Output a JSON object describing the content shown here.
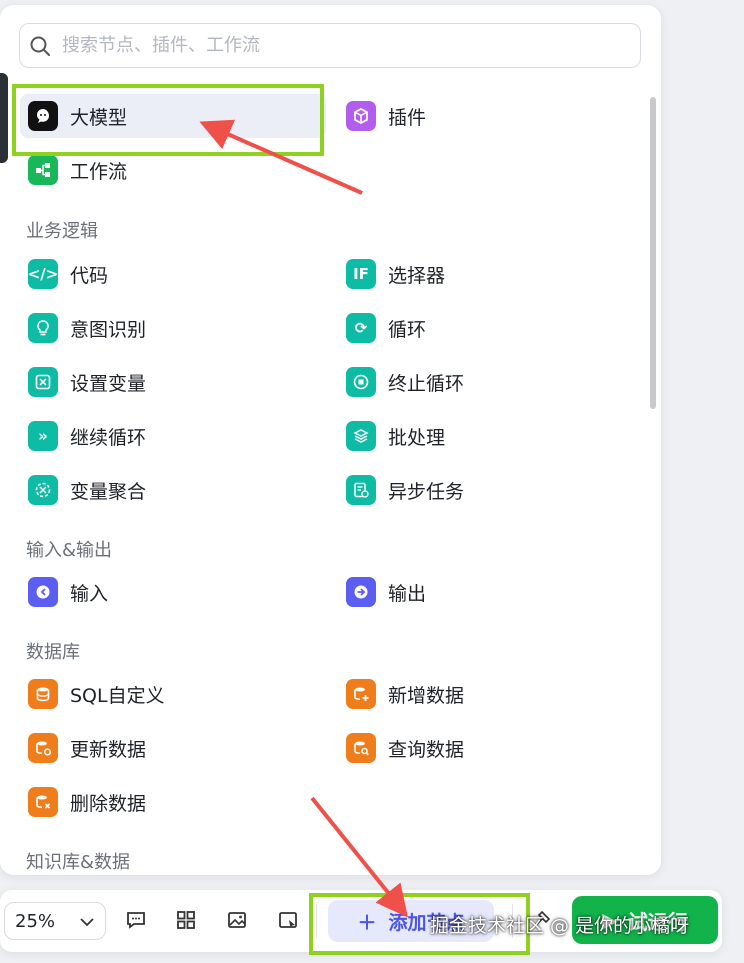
{
  "search": {
    "placeholder": "搜索节点、插件、工作流"
  },
  "top_items": [
    {
      "label": "大模型",
      "icon": "llm-icon"
    },
    {
      "label": "插件",
      "icon": "plugin-cube-icon"
    },
    {
      "label": "工作流",
      "icon": "workflow-icon"
    }
  ],
  "sections": {
    "logic": {
      "title": "业务逻辑",
      "items": [
        {
          "label": "代码",
          "icon": "code-icon"
        },
        {
          "label": "选择器",
          "icon": "if-selector-icon"
        },
        {
          "label": "意图识别",
          "icon": "intent-bulb-icon"
        },
        {
          "label": "循环",
          "icon": "loop-icon"
        },
        {
          "label": "设置变量",
          "icon": "set-variable-icon"
        },
        {
          "label": "终止循环",
          "icon": "stop-loop-icon"
        },
        {
          "label": "继续循环",
          "icon": "continue-loop-icon"
        },
        {
          "label": "批处理",
          "icon": "batch-layers-icon"
        },
        {
          "label": "变量聚合",
          "icon": "variable-aggregate-icon"
        },
        {
          "label": "异步任务",
          "icon": "async-task-icon"
        }
      ]
    },
    "io": {
      "title": "输入&输出",
      "items": [
        {
          "label": "输入",
          "icon": "input-icon"
        },
        {
          "label": "输出",
          "icon": "output-icon"
        }
      ]
    },
    "db": {
      "title": "数据库",
      "items": [
        {
          "label": "SQL自定义",
          "icon": "sql-db-icon"
        },
        {
          "label": "新增数据",
          "icon": "add-data-icon"
        },
        {
          "label": "更新数据",
          "icon": "update-data-icon"
        },
        {
          "label": "查询数据",
          "icon": "query-data-icon"
        },
        {
          "label": "删除数据",
          "icon": "delete-data-icon"
        }
      ]
    },
    "knowledge": {
      "title": "知识库&数据"
    }
  },
  "toolbar": {
    "zoom": "25%",
    "add_node": "添加节点",
    "run": "试运行"
  },
  "watermark": "掘金技术社区 @ 是你的小橘呀",
  "colors": {
    "teal": "#0ebba4",
    "orange": "#f07d1c",
    "indigo": "#5b5ef0",
    "green_run": "#12b34b",
    "highlight_box": "#8fd11f",
    "arrow": "#f0504a"
  }
}
